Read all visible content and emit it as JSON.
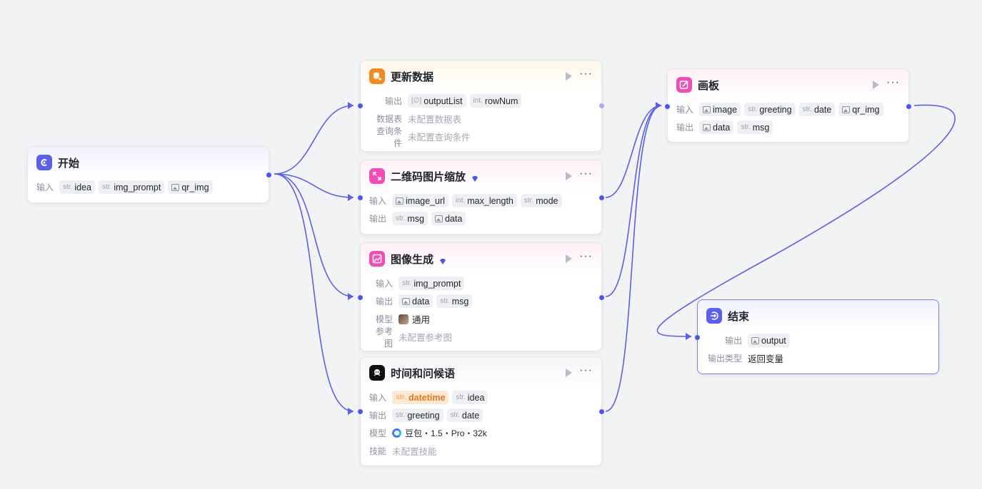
{
  "nodes": {
    "start": {
      "title": "开始",
      "input_label": "输入",
      "inputs": [
        {
          "type": "str.",
          "name": "idea"
        },
        {
          "type": "str.",
          "name": "img_prompt"
        },
        {
          "type": "img",
          "name": "qr_img"
        }
      ]
    },
    "update": {
      "title": "更新数据",
      "output_label": "输出",
      "outputs": [
        {
          "type": "[∅]",
          "name": "outputList"
        },
        {
          "type": "int.",
          "name": "rowNum"
        }
      ],
      "table_label": "数据表",
      "table_value": "未配置数据表",
      "query_label": "查询条件",
      "query_value": "未配置查询条件"
    },
    "qr_scale": {
      "title": "二维码图片缩放",
      "input_label": "输入",
      "inputs": [
        {
          "type": "img",
          "name": "image_url"
        },
        {
          "type": "int.",
          "name": "max_length"
        },
        {
          "type": "str.",
          "name": "mode"
        }
      ],
      "output_label": "输出",
      "outputs": [
        {
          "type": "str.",
          "name": "msg"
        },
        {
          "type": "img",
          "name": "data"
        }
      ]
    },
    "image_gen": {
      "title": "图像生成",
      "input_label": "输入",
      "inputs": [
        {
          "type": "str.",
          "name": "img_prompt"
        }
      ],
      "output_label": "输出",
      "outputs": [
        {
          "type": "img",
          "name": "data"
        },
        {
          "type": "str.",
          "name": "msg"
        }
      ],
      "model_label": "模型",
      "model_value": "通用",
      "ref_label": "参考图",
      "ref_value": "未配置参考图"
    },
    "greeting": {
      "title": "时间和问候语",
      "input_label": "输入",
      "inputs": [
        {
          "type": "str.",
          "name": "datetime"
        },
        {
          "type": "str.",
          "name": "idea"
        }
      ],
      "output_label": "输出",
      "outputs": [
        {
          "type": "str.",
          "name": "greeting"
        },
        {
          "type": "str.",
          "name": "date"
        }
      ],
      "model_label": "模型",
      "model_value": "豆包・1.5・Pro・32k",
      "skill_label": "技能",
      "skill_value": "未配置技能"
    },
    "canvas": {
      "title": "画板",
      "input_label": "输入",
      "inputs": [
        {
          "type": "img",
          "name": "image"
        },
        {
          "type": "str.",
          "name": "greeting"
        },
        {
          "type": "str.",
          "name": "date"
        },
        {
          "type": "img",
          "name": "qr_img"
        }
      ],
      "output_label": "输出",
      "outputs": [
        {
          "type": "img",
          "name": "data"
        },
        {
          "type": "str.",
          "name": "msg"
        }
      ]
    },
    "end": {
      "title": "结束",
      "output_label": "输出",
      "outputs": [
        {
          "type": "img",
          "name": "output"
        }
      ],
      "type_label": "输出类型",
      "type_value": "返回变量"
    }
  },
  "colors": {
    "edge": "#5b5fe9",
    "start_icon": "#5b5fe9",
    "update_icon": "#f08a24",
    "qr_icon": "#ee4fb5",
    "image_icon": "#ee4fb5",
    "greeting_icon": "#111111",
    "canvas_icon": "#ee4fb5",
    "end_icon": "#5b5fe9",
    "pro_diamond": "#4e56e6"
  }
}
